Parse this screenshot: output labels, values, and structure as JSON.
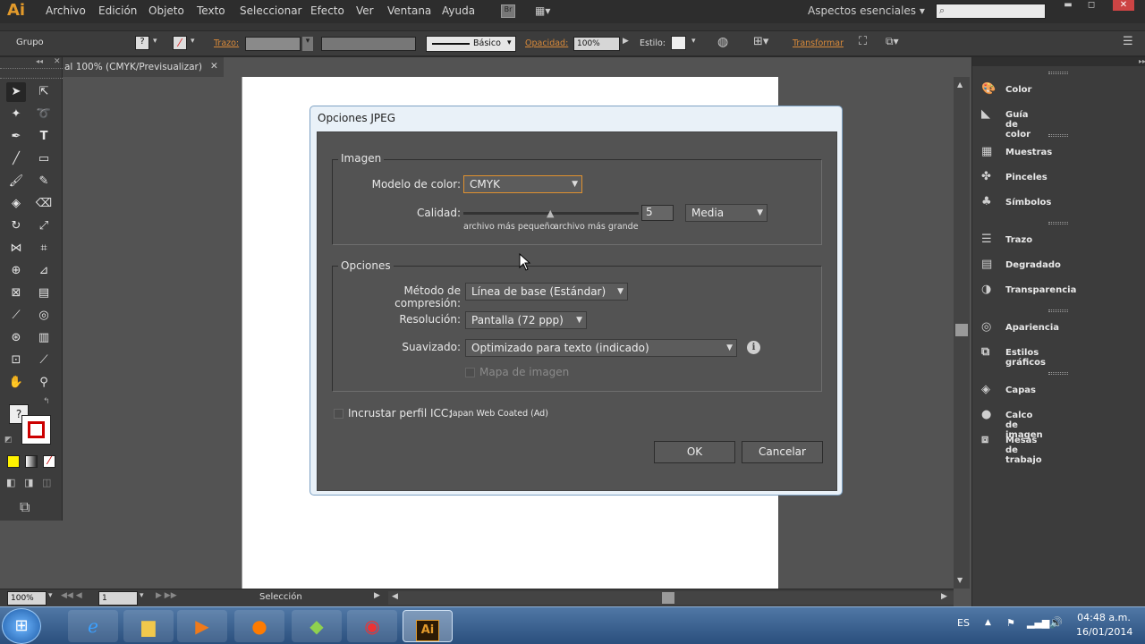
{
  "app": {
    "logo": "Ai"
  },
  "menu": [
    "Archivo",
    "Edición",
    "Objeto",
    "Texto",
    "Seleccionar",
    "Efecto",
    "Ver",
    "Ventana",
    "Ayuda"
  ],
  "workspace": "Aspectos esenciales",
  "control": {
    "group_label": "Grupo",
    "stroke_label": "Trazo:",
    "brush_label": "Básico",
    "opacity_label": "Opacidad:",
    "opacity_value": "100%",
    "style_label": "Estilo:",
    "transform_label": "Transformar"
  },
  "doc_tab": "al 100% (CMYK/Previsualizar)",
  "status": {
    "zoom": "100%",
    "artboard": "1",
    "tool": "Selección"
  },
  "dialog": {
    "title": "Opciones JPEG",
    "image_group": "Imagen",
    "color_model_label": "Modelo de color:",
    "color_model_value": "CMYK",
    "quality_label": "Calidad:",
    "quality_value": "5",
    "quality_preset": "Media",
    "quality_fraction": 0.5,
    "small_file": "archivo más pequeño",
    "large_file": "archivo más grande",
    "options_group": "Opciones",
    "compression_label": "Método de compresión:",
    "compression_value": "Línea de base (Estándar)",
    "resolution_label": "Resolución:",
    "resolution_value": "Pantalla (72 ppp)",
    "antialias_label": "Suavizado:",
    "antialias_value": "Optimizado para texto (indicado)",
    "imagemap_label": "Mapa de imagen",
    "icc_label": "Incrustar perfil ICC:",
    "icc_value": "Japan Web Coated (Ad)",
    "ok": "OK",
    "cancel": "Cancelar"
  },
  "panels": [
    {
      "icon": "color-icon",
      "label": "Color"
    },
    {
      "icon": "color-guide-icon",
      "label": "Guía de color"
    },
    {
      "icon": "swatches-icon",
      "label": "Muestras"
    },
    {
      "icon": "brushes-icon",
      "label": "Pinceles"
    },
    {
      "icon": "symbols-icon",
      "label": "Símbolos"
    },
    {
      "icon": "stroke-icon",
      "label": "Trazo"
    },
    {
      "icon": "gradient-icon",
      "label": "Degradado"
    },
    {
      "icon": "transparency-icon",
      "label": "Transparencia"
    },
    {
      "icon": "appearance-icon",
      "label": "Apariencia"
    },
    {
      "icon": "graphic-styles-icon",
      "label": "Estilos gráficos"
    },
    {
      "icon": "layers-icon",
      "label": "Capas"
    },
    {
      "icon": "image-trace-icon",
      "label": "Calco de imagen"
    },
    {
      "icon": "artboards-icon",
      "label": "Mesas de trabajo"
    }
  ],
  "taskbar": {
    "lang": "ES",
    "time": "04:48 a.m.",
    "date": "16/01/2014"
  },
  "colors": {
    "accent": "#e29a2b",
    "dialog_frame": "#e9f1f8",
    "dialog_body": "#535353"
  }
}
